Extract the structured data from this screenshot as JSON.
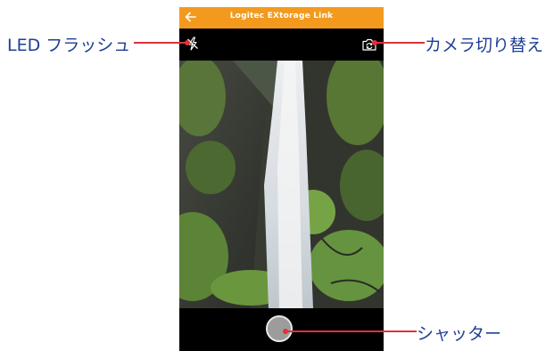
{
  "app_bar": {
    "title": "Logitec EXtorage Link",
    "back_icon": "arrow-left-icon",
    "color": "#f39a1e"
  },
  "camera_controls": {
    "flash_icon": "flash-off-icon",
    "switch_icon": "camera-switch-icon"
  },
  "shutter": {
    "icon": "shutter-circle"
  },
  "callouts": {
    "flash_label": "LED フラッシュ",
    "switch_label": "カメラ切り替え",
    "shutter_label": "シャッター",
    "line_color": "#e0313a",
    "text_color": "#1f3f96"
  }
}
